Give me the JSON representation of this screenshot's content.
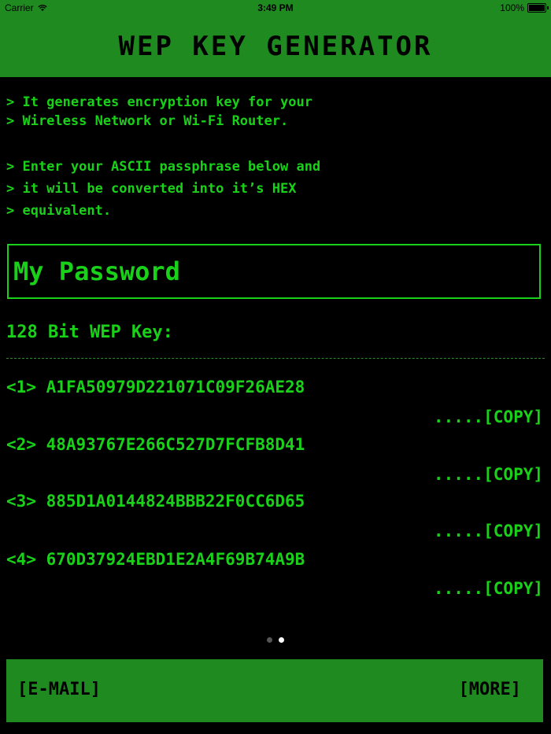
{
  "status": {
    "carrier": "Carrier",
    "time": "3:49 PM",
    "battery": "100%"
  },
  "header": {
    "title": "WEP KEY GENERATOR"
  },
  "intro": {
    "lines1": [
      "> It generates encryption key for your",
      "> Wireless Network or Wi-Fi Router."
    ],
    "lines2": [
      "> Enter your ASCII passphrase below and",
      "> it will be converted into it’s HEX",
      "> equivalent."
    ]
  },
  "passphrase": {
    "value": "My Password"
  },
  "key_section": {
    "label": "128 Bit WEP Key:"
  },
  "keys": [
    {
      "index": "<1>",
      "value": "A1FA50979D221071C09F26AE28",
      "copy_label": ".....[COPY]"
    },
    {
      "index": "<2>",
      "value": "48A93767E266C527D7FCFB8D41",
      "copy_label": ".....[COPY]"
    },
    {
      "index": "<3>",
      "value": "885D1A0144824BBB22F0CC6D65",
      "copy_label": ".....[COPY]"
    },
    {
      "index": "<4>",
      "value": "670D37924EBD1E2A4F69B74A9B",
      "copy_label": ".....[COPY]"
    }
  ],
  "page_control": {
    "pages": 2,
    "current": 2
  },
  "footer": {
    "email_label": "[E-MAIL]",
    "more_label": "[MORE]"
  },
  "colors": {
    "accent_green": "#1f8a1f",
    "text_green": "#19d119",
    "background": "#000000"
  }
}
